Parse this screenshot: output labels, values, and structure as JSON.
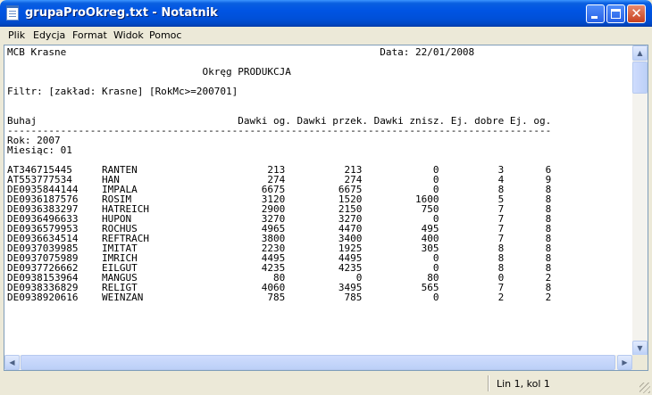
{
  "window": {
    "title": "grupaProOkreg.txt - Notatnik"
  },
  "menu": [
    {
      "label": "Plik"
    },
    {
      "label": "Edycja"
    },
    {
      "label": "Format"
    },
    {
      "label": "Widok"
    },
    {
      "label": "Pomoc"
    }
  ],
  "document": {
    "lines": [
      "MCB Krasne                                                     Data: 22/01/2008",
      "",
      "                                 Okręg PRODUKCJA",
      "",
      "Filtr: [zakład: Krasne] [RokMc>=200701]",
      "",
      "",
      "Buhaj                                  Dawki og. Dawki przek. Dawki znisz. Ej. dobre Ej. og.",
      "--------------------------------------------------------------------------------------------",
      "Rok: 2007",
      "Miesiąc: 01",
      "",
      "AT346715445     RANTEN                      213          213            0          3       6",
      "AT553777534     HAN                         274          274            0          4       9",
      "DE0935844144    IMPALA                     6675         6675            0          8       8",
      "DE0936187576    ROSIM                      3120         1520         1600          5       8",
      "DE0936383297    HATREICH                   2900         2150          750          7       8",
      "DE0936496633    HUPON                      3270         3270            0          7       8",
      "DE0936579953    ROCHUS                     4965         4470          495          7       8",
      "DE0936634514    REFTRACH                   3800         3400          400          7       8",
      "DE0937039985    IMITAT                     2230         1925          305          8       8",
      "DE0937075989    IMRICH                     4495         4495            0          8       8",
      "DE0937726662    EILGUT                     4235         4235            0          8       8",
      "DE0938153964    MANGUS                       80            0           80          0       2",
      "DE0938336829    RELIGT                     4060         3495          565          7       8",
      "DE0938920616    WEINZAN                     785          785            0          2       2"
    ]
  },
  "status": {
    "position": "Lin 1, kol 1"
  },
  "scroll": {
    "vertical_position": 0,
    "horizontal_position": 0
  },
  "colors": {
    "title_bar": "#0054e3",
    "close_button": "#c8411f",
    "chrome": "#ece9d8",
    "editor_background": "#ffffff"
  }
}
